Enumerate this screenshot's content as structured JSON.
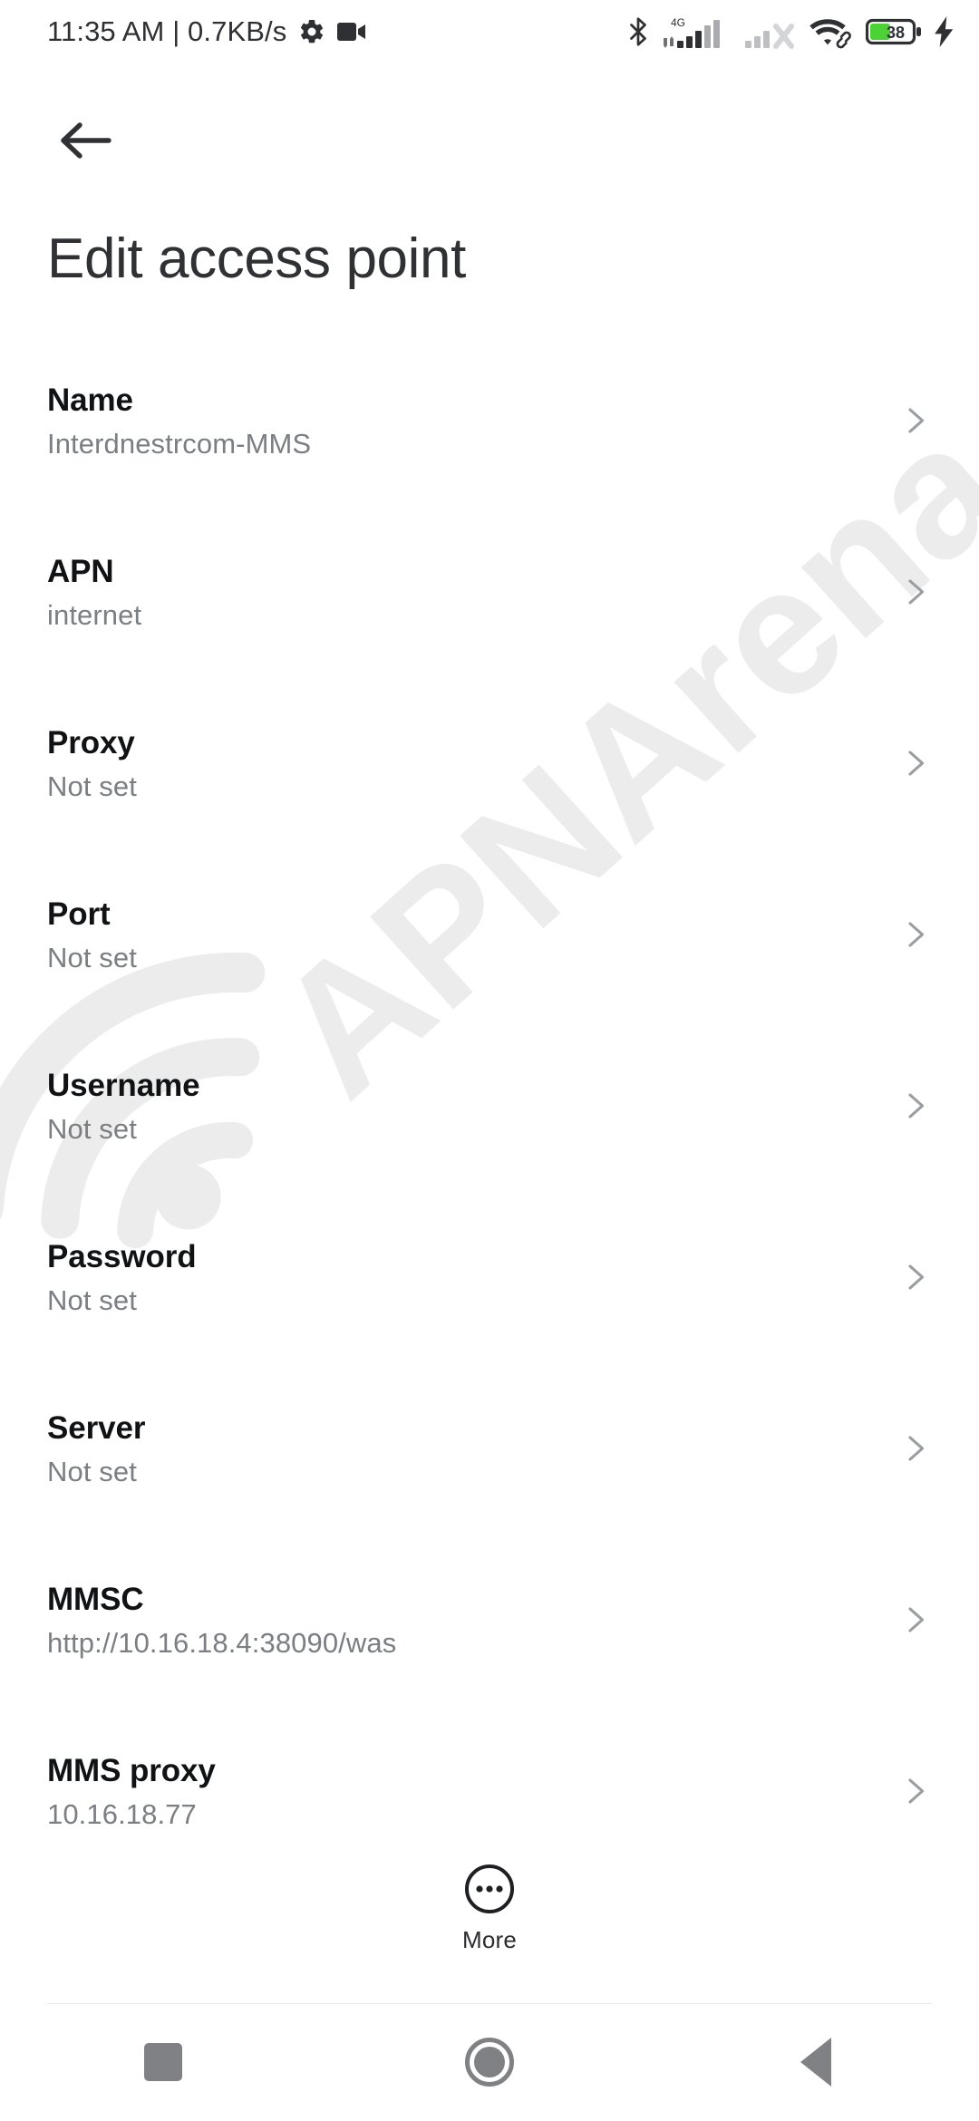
{
  "status_bar": {
    "clock": "11:35 AM | 0.7KB/s",
    "gear_icon": "gear-icon",
    "video_icon": "video-camera-icon",
    "bluetooth_icon": "bluetooth-icon",
    "network_type": "4G",
    "sim1_icon": "signal-sim1-icon",
    "sim2_icon": "signal-sim2-no-service-icon",
    "wifi_icon": "wifi-icon",
    "battery_level": "38",
    "battery_icon": "battery-icon",
    "charging_icon": "charging-bolt-icon",
    "battery_color": "#4CD137"
  },
  "topbar": {
    "back_icon": "back-arrow-icon"
  },
  "header": {
    "title": "Edit access point"
  },
  "watermark": {
    "text": "APNArena",
    "color": "#ececec"
  },
  "settings_list": [
    {
      "label": "Name",
      "value": "Interdnestrcom-MMS"
    },
    {
      "label": "APN",
      "value": "internet"
    },
    {
      "label": "Proxy",
      "value": "Not set"
    },
    {
      "label": "Port",
      "value": "Not set"
    },
    {
      "label": "Username",
      "value": "Not set"
    },
    {
      "label": "Password",
      "value": "Not set"
    },
    {
      "label": "Server",
      "value": "Not set"
    },
    {
      "label": "MMSC",
      "value": "http://10.16.18.4:38090/was"
    },
    {
      "label": "MMS proxy",
      "value": "10.16.18.77"
    }
  ],
  "more_button": {
    "label": "More",
    "icon": "more-dots-circle-icon"
  },
  "nav_bar": {
    "recents": "recents-square-icon",
    "home": "home-circle-icon",
    "back": "back-triangle-icon"
  }
}
